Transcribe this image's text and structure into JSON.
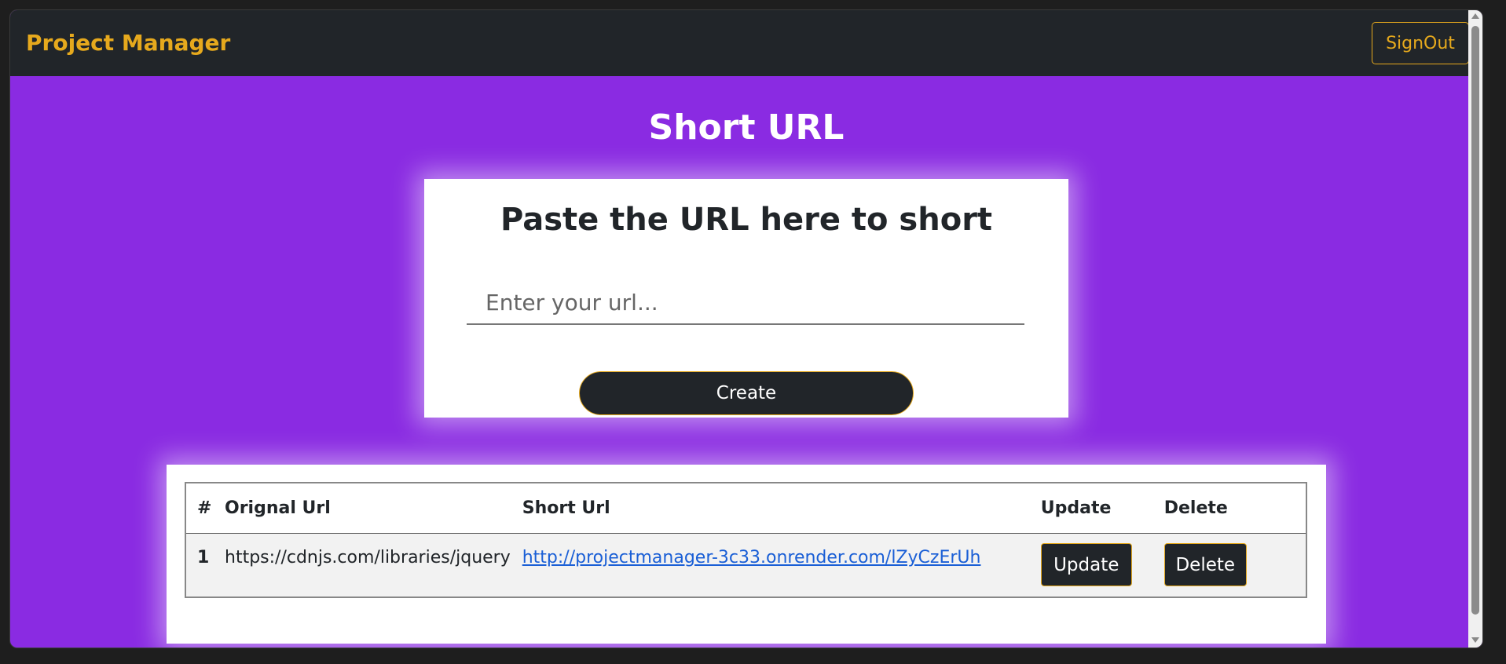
{
  "navbar": {
    "brand": "Project Manager",
    "signout_label": "SignOut"
  },
  "main": {
    "title": "Short URL",
    "form": {
      "heading": "Paste the URL here to short",
      "input_placeholder": "Enter your url...",
      "input_value": "",
      "create_label": "Create"
    },
    "table": {
      "headers": [
        "#",
        "Orignal Url",
        "Short Url",
        "Update",
        "Delete"
      ],
      "rows": [
        {
          "num": "1",
          "original": "https://cdnjs.com/libraries/jquery",
          "short": "http://projectmanager-3c33.onrender.com/lZyCzErUh",
          "update_label": "Update",
          "delete_label": "Delete"
        }
      ]
    }
  },
  "colors": {
    "accent": "#e6a91d",
    "background": "#8a2be2",
    "navbar": "#212529",
    "link": "#1a5fd6"
  }
}
